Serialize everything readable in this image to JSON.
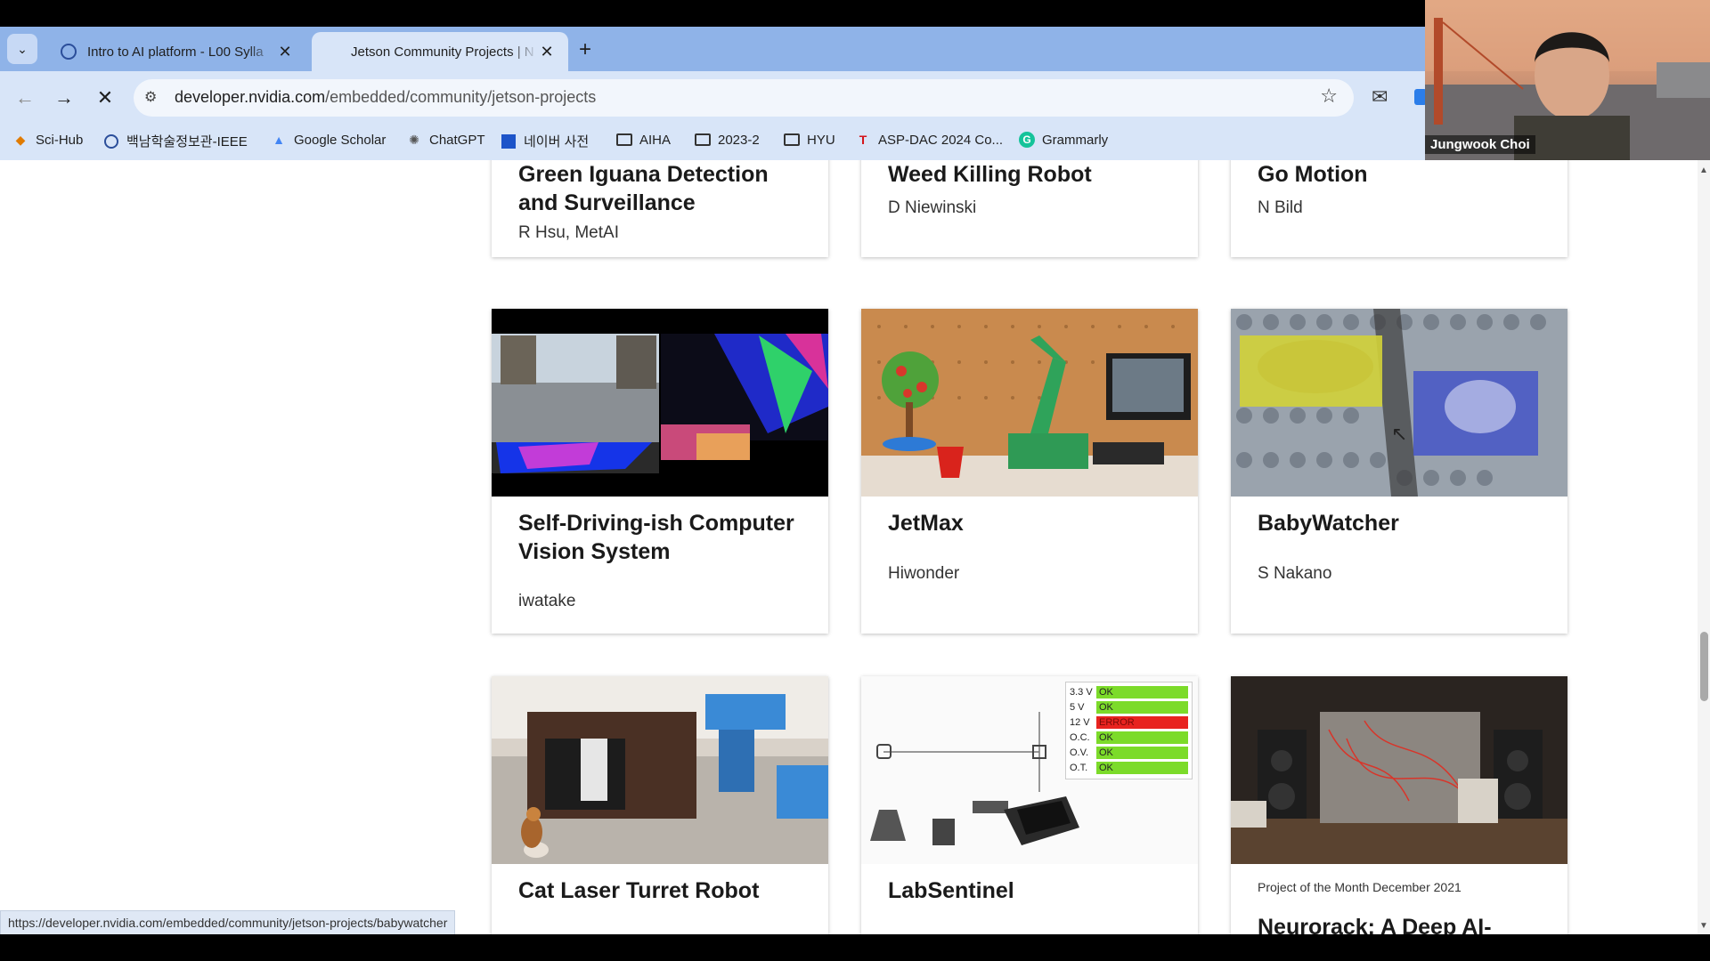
{
  "tabs": [
    {
      "title": "Intro to AI platform - L00 Sylla",
      "active": false
    },
    {
      "title": "Jetson Community Projects | N",
      "active": true
    }
  ],
  "toolbar": {
    "url_host": "developer.nvidia.com",
    "url_path": "/embedded/community/jetson-projects"
  },
  "bookmarks": [
    {
      "label": "Sci-Hub",
      "icon": "sci-hub-icon"
    },
    {
      "label": "백남학술정보관-IEEE",
      "icon": "library-icon"
    },
    {
      "label": "Google Scholar",
      "icon": "scholar-icon"
    },
    {
      "label": "ChatGPT",
      "icon": "chatgpt-icon"
    },
    {
      "label": "네이버 사전",
      "icon": "naver-icon"
    },
    {
      "label": "AIHA",
      "icon": "folder-icon"
    },
    {
      "label": "2023-2",
      "icon": "folder-icon"
    },
    {
      "label": "HYU",
      "icon": "folder-icon"
    },
    {
      "label": "ASP-DAC 2024 Co...",
      "icon": "aspdac-icon"
    },
    {
      "label": "Grammarly",
      "icon": "grammarly-icon"
    }
  ],
  "cards": [
    {
      "title": "Green Iguana Detection and Surveillance",
      "author": "R Hsu, MetAI"
    },
    {
      "title": "Weed Killing Robot",
      "author": "D Niewinski"
    },
    {
      "title": "Go Motion",
      "author": "N Bild"
    },
    {
      "title": "Self-Driving-ish Computer Vision System",
      "author": "iwatake"
    },
    {
      "title": "JetMax",
      "author": "Hiwonder"
    },
    {
      "title": "BabyWatcher",
      "author": "S Nakano"
    },
    {
      "title": "Cat Laser Turret Robot",
      "author": ""
    },
    {
      "title": "LabSentinel",
      "author": ""
    },
    {
      "title": "Neurorack: A Deep AI-",
      "kicker": "Project of the Month December 2021"
    }
  ],
  "labsentinel_checks": [
    {
      "label": "3.3 V",
      "status": "OK",
      "color": "#7cdb2a"
    },
    {
      "label": "5 V",
      "status": "OK",
      "color": "#7cdb2a"
    },
    {
      "label": "12 V",
      "status": "ERROR",
      "color": "#e8231f"
    },
    {
      "label": "O.C.",
      "status": "OK",
      "color": "#7cdb2a"
    },
    {
      "label": "O.V.",
      "status": "OK",
      "color": "#7cdb2a"
    },
    {
      "label": "O.T.",
      "status": "OK",
      "color": "#7cdb2a"
    }
  ],
  "status_url": "https://developer.nvidia.com/embedded/community/jetson-projects/babywatcher",
  "video": {
    "participant_name": "Jungwook Choi"
  }
}
